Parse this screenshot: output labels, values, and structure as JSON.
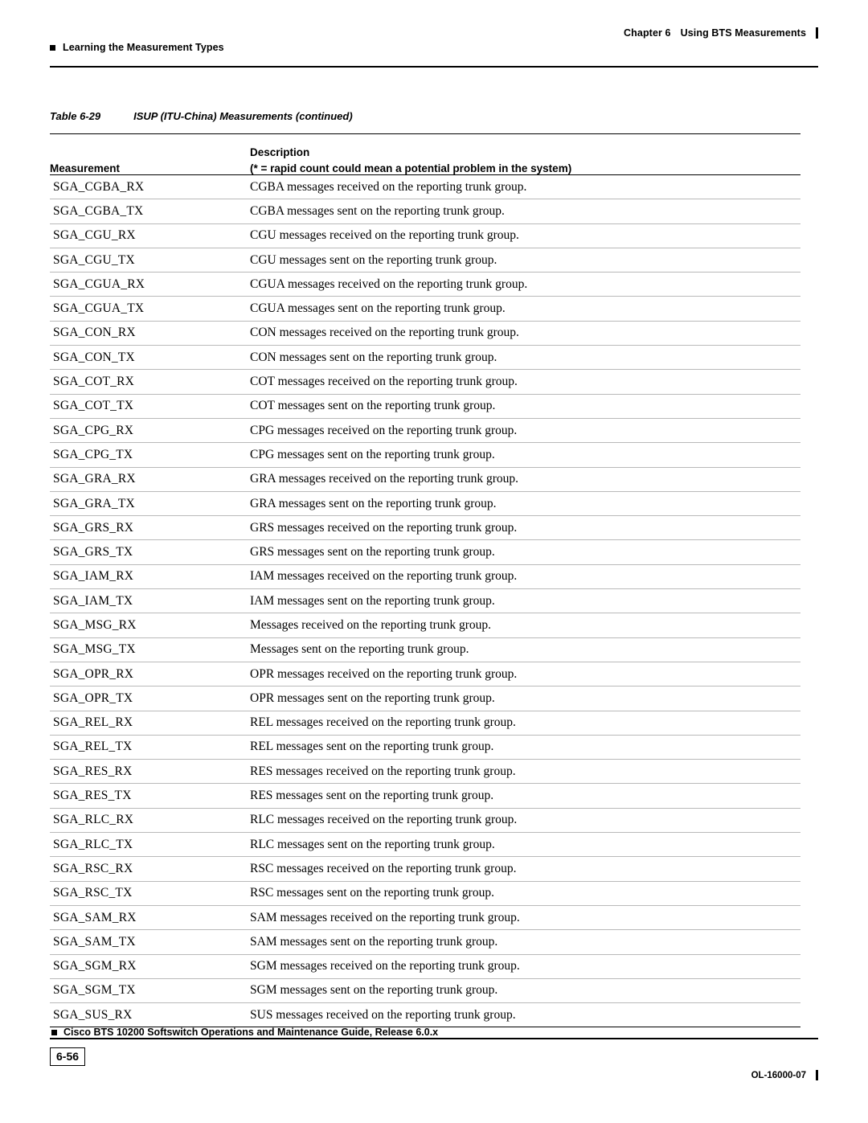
{
  "header": {
    "left_text": "Learning the Measurement Types",
    "chapter_label": "Chapter 6",
    "chapter_title": "Using BTS Measurements"
  },
  "caption": {
    "number": "Table 6-29",
    "title": "ISUP (ITU-China) Measurements (continued)"
  },
  "table": {
    "headers": {
      "measurement": "Measurement",
      "description_line1": "Description",
      "description_line2": "(* = rapid count could mean a potential problem in the system)"
    },
    "rows": [
      {
        "measurement": "SGA_CGBA_RX",
        "description": "CGBA messages received on the reporting trunk group."
      },
      {
        "measurement": "SGA_CGBA_TX",
        "description": "CGBA messages sent on the reporting trunk group."
      },
      {
        "measurement": "SGA_CGU_RX",
        "description": "CGU messages received on the reporting trunk group."
      },
      {
        "measurement": "SGA_CGU_TX",
        "description": "CGU messages sent on the reporting trunk group."
      },
      {
        "measurement": "SGA_CGUA_RX",
        "description": "CGUA messages received on the reporting trunk group."
      },
      {
        "measurement": "SGA_CGUA_TX",
        "description": "CGUA messages sent on the reporting trunk group."
      },
      {
        "measurement": "SGA_CON_RX",
        "description": "CON messages received on the reporting trunk group."
      },
      {
        "measurement": "SGA_CON_TX",
        "description": "CON messages sent on the reporting trunk group."
      },
      {
        "measurement": "SGA_COT_RX",
        "description": "COT messages received on the reporting trunk group."
      },
      {
        "measurement": "SGA_COT_TX",
        "description": "COT messages sent on the reporting trunk group."
      },
      {
        "measurement": "SGA_CPG_RX",
        "description": "CPG messages received on the reporting trunk group."
      },
      {
        "measurement": "SGA_CPG_TX",
        "description": "CPG messages sent on the reporting trunk group."
      },
      {
        "measurement": "SGA_GRA_RX",
        "description": "GRA messages received on the reporting trunk group."
      },
      {
        "measurement": "SGA_GRA_TX",
        "description": "GRA messages sent on the reporting trunk group."
      },
      {
        "measurement": "SGA_GRS_RX",
        "description": "GRS messages received on the reporting trunk group."
      },
      {
        "measurement": "SGA_GRS_TX",
        "description": "GRS messages sent on the reporting trunk group."
      },
      {
        "measurement": "SGA_IAM_RX",
        "description": "IAM messages received on the reporting trunk group."
      },
      {
        "measurement": "SGA_IAM_TX",
        "description": "IAM messages sent on the reporting trunk group."
      },
      {
        "measurement": "SGA_MSG_RX",
        "description": "Messages received on the reporting trunk group."
      },
      {
        "measurement": "SGA_MSG_TX",
        "description": "Messages sent on the reporting trunk group."
      },
      {
        "measurement": "SGA_OPR_RX",
        "description": "OPR messages received on the reporting trunk group."
      },
      {
        "measurement": "SGA_OPR_TX",
        "description": "OPR messages sent on the reporting trunk group."
      },
      {
        "measurement": "SGA_REL_RX",
        "description": "REL messages received on the reporting trunk group."
      },
      {
        "measurement": "SGA_REL_TX",
        "description": "REL messages sent on the reporting trunk group."
      },
      {
        "measurement": "SGA_RES_RX",
        "description": "RES messages received on the reporting trunk group."
      },
      {
        "measurement": "SGA_RES_TX",
        "description": "RES messages sent on the reporting trunk group."
      },
      {
        "measurement": "SGA_RLC_RX",
        "description": "RLC messages received on the reporting trunk group."
      },
      {
        "measurement": "SGA_RLC_TX",
        "description": "RLC messages sent on the reporting trunk group."
      },
      {
        "measurement": "SGA_RSC_RX",
        "description": "RSC messages received on the reporting trunk group."
      },
      {
        "measurement": "SGA_RSC_TX",
        "description": "RSC messages sent on the reporting trunk group."
      },
      {
        "measurement": "SGA_SAM_RX",
        "description": "SAM messages received on the reporting trunk group."
      },
      {
        "measurement": "SGA_SAM_TX",
        "description": "SAM messages sent on the reporting trunk group."
      },
      {
        "measurement": "SGA_SGM_RX",
        "description": "SGM messages received on the reporting trunk group."
      },
      {
        "measurement": "SGA_SGM_TX",
        "description": "SGM messages sent on the reporting trunk group."
      },
      {
        "measurement": "SGA_SUS_RX",
        "description": "SUS messages received on the reporting trunk group."
      }
    ]
  },
  "footer": {
    "guide_title": "Cisco BTS 10200 Softswitch Operations and Maintenance Guide, Release 6.0.x",
    "page_number": "6-56",
    "doc_id": "OL-16000-07"
  }
}
